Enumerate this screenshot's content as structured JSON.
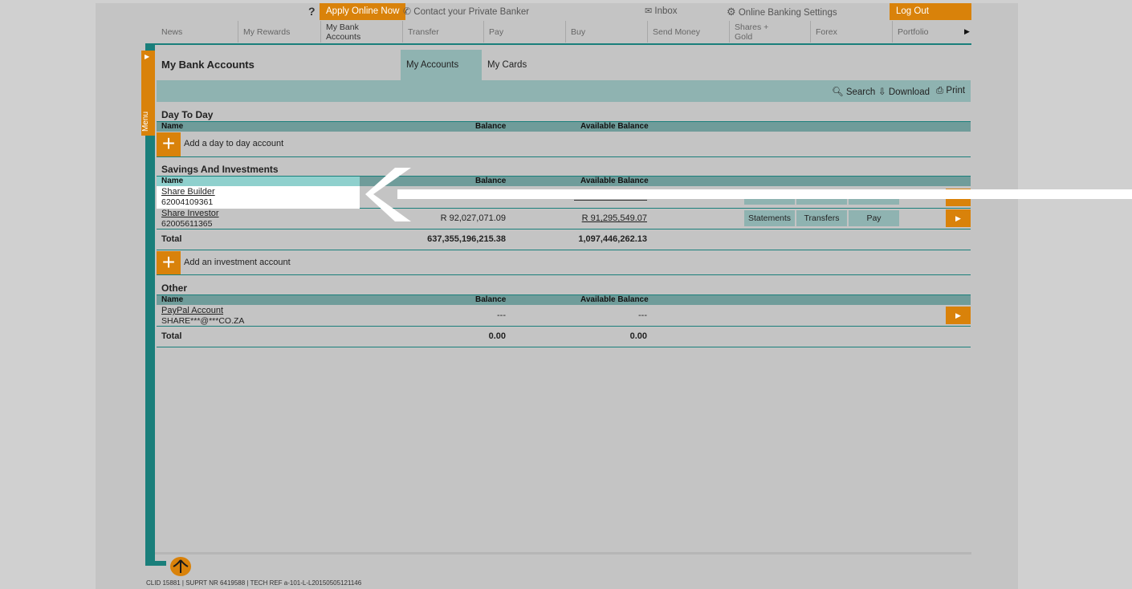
{
  "utility_bar": {
    "help": "?",
    "apply_online": "Apply Online Now",
    "contact_banker": "Contact your Private Banker",
    "inbox": "Inbox",
    "settings": "Online Banking Settings",
    "logout": "Log Out"
  },
  "nav": {
    "items": [
      {
        "label": "News"
      },
      {
        "label": "My Rewards"
      },
      {
        "label": "My Bank Accounts",
        "line1": "My Bank",
        "line2": "Accounts"
      },
      {
        "label": "Transfer"
      },
      {
        "label": "Pay"
      },
      {
        "label": "Buy"
      },
      {
        "label": "Send Money"
      },
      {
        "label": "Shares + Gold",
        "line1": "Shares +",
        "line2": "Gold"
      },
      {
        "label": "Forex"
      },
      {
        "label": "Portfolio"
      }
    ]
  },
  "menu": {
    "label": "Menu"
  },
  "page": {
    "title": "My Bank Accounts",
    "tabs": [
      {
        "label": "My Accounts",
        "active": true
      },
      {
        "label": "My Cards",
        "active": false
      }
    ],
    "toolbar": {
      "search": "Search",
      "download": "Download",
      "print": "Print"
    }
  },
  "columns": {
    "name": "Name",
    "balance": "Balance",
    "available": "Available Balance"
  },
  "sections": {
    "day_to_day": {
      "title": "Day To Day",
      "add_label": "Add a day to day account"
    },
    "savings": {
      "title": "Savings And Investments",
      "accounts": [
        {
          "name": "Share Builder",
          "number": "62004109361"
        },
        {
          "name": "Share Investor",
          "number": "62005611365",
          "balance": "R 92,027,071.09",
          "available": "R 91,295,549.07"
        }
      ],
      "actions": {
        "statements": "Statements",
        "transfers": "Transfers",
        "pay": "Pay"
      },
      "total_label": "Total",
      "total_balance": "637,355,196,215.38",
      "total_available": "1,097,446,262.13",
      "add_label": "Add an investment account"
    },
    "other": {
      "title": "Other",
      "accounts": [
        {
          "name": "PayPal Account",
          "number": "SHARE***@***CO.ZA",
          "balance": "---",
          "available": "---"
        }
      ],
      "total_label": "Total",
      "total_balance": "0.00",
      "total_available": "0.00"
    }
  },
  "footer": {
    "text": "CLID 15881 | SUPRT NR 6419588 | TECH REF a-101-L-L20150505121146"
  },
  "colors": {
    "accent": "#d9820a",
    "teal": "#1a7f7b",
    "teal_light": "#8fb3b1",
    "highlight": "#ffffff"
  }
}
